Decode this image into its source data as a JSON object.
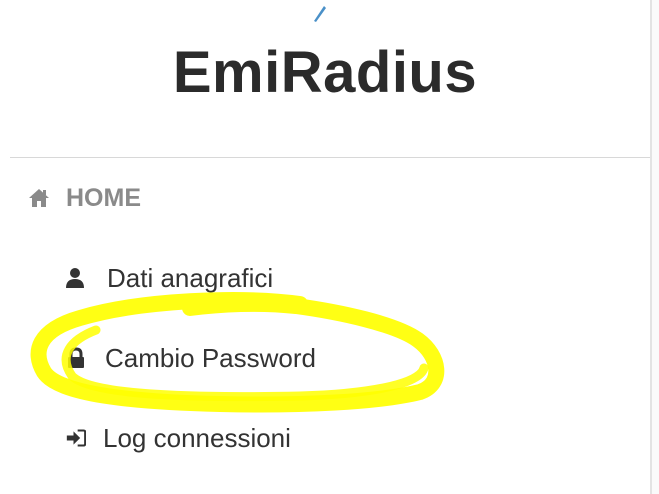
{
  "brand": {
    "title": "EmiRadius",
    "logo_icon": "logo-fragment"
  },
  "nav": {
    "home": {
      "label": "HOME",
      "icon": "home-icon"
    },
    "items": [
      {
        "label": "Dati anagrafici",
        "icon": "user-icon"
      },
      {
        "label": "Cambio Password",
        "icon": "lock-icon"
      },
      {
        "label": "Log connessioni",
        "icon": "sign-in-icon"
      }
    ]
  },
  "annotation": {
    "color": "#ffff00",
    "target": "Cambio Password"
  },
  "colors": {
    "text": "#333333",
    "muted": "#8a8a8a",
    "brand": "#2b2b2b",
    "logo_accent": "#4a90c8"
  }
}
